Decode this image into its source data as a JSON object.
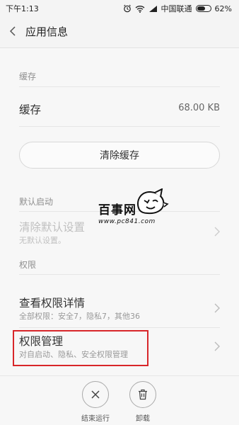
{
  "status_bar": {
    "time": "下午1:13",
    "carrier": "中国联通",
    "battery_text": "62%",
    "battery_level": 0.62
  },
  "header": {
    "title": "应用信息",
    "back_icon": "chevron-left-icon"
  },
  "cache_section": {
    "label": "缓存",
    "row_title": "缓存",
    "row_value": "68.00 KB",
    "clear_button": "清除缓存"
  },
  "default_launch_section": {
    "label": "默认启动",
    "row_title": "清除默认设置",
    "row_sub": "无默认设置。"
  },
  "permissions_section": {
    "label": "权限",
    "detail_title": "查看权限详情",
    "detail_sub": "全部权限：安全7，隐私7，其他36",
    "manage_title": "权限管理",
    "manage_sub": "对自启动、隐私、安全权限管理"
  },
  "watermark": {
    "text": "百事网",
    "sub": "www.pc841.com"
  },
  "bottom_actions": {
    "stop_label": "结束运行",
    "uninstall_label": "卸载"
  },
  "colors": {
    "highlight": "#d8262a"
  }
}
